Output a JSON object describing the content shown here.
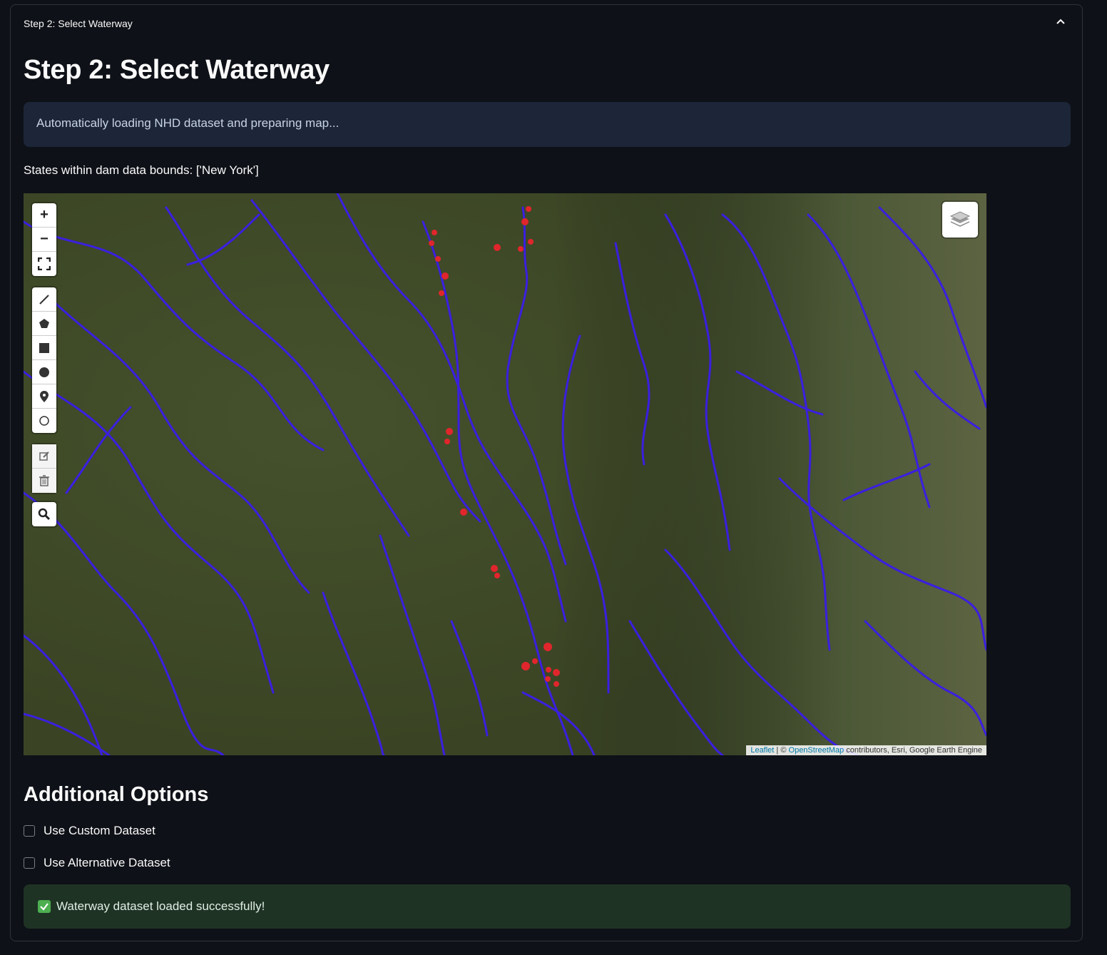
{
  "expander": {
    "header": "Step 2: Select Waterway",
    "toggle_icon": "chevron-up-icon"
  },
  "title": "Step 2: Select Waterway",
  "info_message": "Automatically loading NHD dataset and preparing map...",
  "states_text": "States within dam data bounds: ['New York']",
  "map": {
    "zoom_in": "+",
    "zoom_out": "−",
    "controls": [
      "fullscreen-icon",
      "draw-polyline-icon",
      "draw-polygon-icon",
      "draw-rectangle-icon",
      "draw-circle-icon",
      "draw-marker-icon",
      "draw-circlemarker-icon",
      "edit-icon",
      "delete-icon",
      "search-icon"
    ],
    "layer_control_icon": "layers-icon",
    "attribution": {
      "leaflet": "Leaflet",
      "sep": "| ©",
      "osm": "OpenStreetMap",
      "rest": "contributors, Esri, Google Earth Engine"
    },
    "colors": {
      "waterway": "#3b1fe0",
      "dam_marker": "#e0262c",
      "satellite_base": "#3d4a2a"
    }
  },
  "options": {
    "title": "Additional Options",
    "custom_dataset": "Use Custom Dataset",
    "alternative_dataset": "Use Alternative Dataset"
  },
  "success_message": "Waterway dataset loaded successfully!",
  "colors": {
    "background": "#0e1117",
    "info_bg": "#1c2638",
    "success_bg": "#1f3324"
  }
}
